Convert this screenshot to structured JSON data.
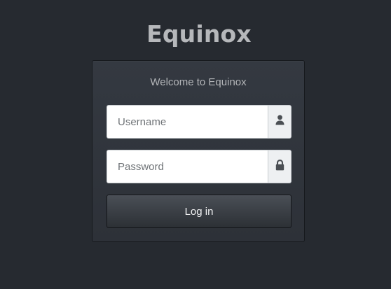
{
  "app": {
    "title": "Equinox"
  },
  "login": {
    "welcome": "Welcome to Equinox",
    "username": {
      "placeholder": "Username",
      "value": "",
      "icon": "user-icon"
    },
    "password": {
      "placeholder": "Password",
      "value": "",
      "icon": "lock-icon"
    },
    "submit_label": "Log in"
  },
  "colors": {
    "background": "#262a30",
    "card": "#31353c",
    "title": "#b6b8bb",
    "button_text": "#f1f2f3"
  }
}
